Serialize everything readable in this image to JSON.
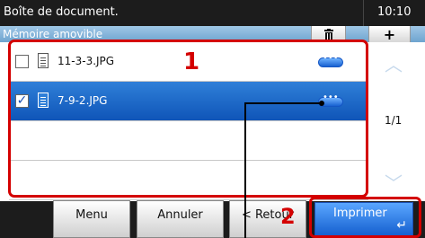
{
  "header": {
    "title": "Boîte de document.",
    "time": "10:10"
  },
  "subheader": {
    "title": "Mémoire amovible",
    "delete_icon": "trash-icon",
    "add_icon": "plus-icon",
    "add_label": "+"
  },
  "files": [
    {
      "name": "11-3-3.JPG",
      "checked": false,
      "selected": false
    },
    {
      "name": "7-9-2.JPG",
      "checked": true,
      "selected": true
    }
  ],
  "pager": {
    "label": "1/1"
  },
  "buttons": {
    "menu": "Menu",
    "cancel": "Annuler",
    "back": "< Retour",
    "print": "Imprimer",
    "enter_symbol": "↵"
  },
  "annotations": {
    "one": "1",
    "two": "2"
  },
  "colors": {
    "accent": "#1560cf",
    "annotation": "#d40000"
  }
}
